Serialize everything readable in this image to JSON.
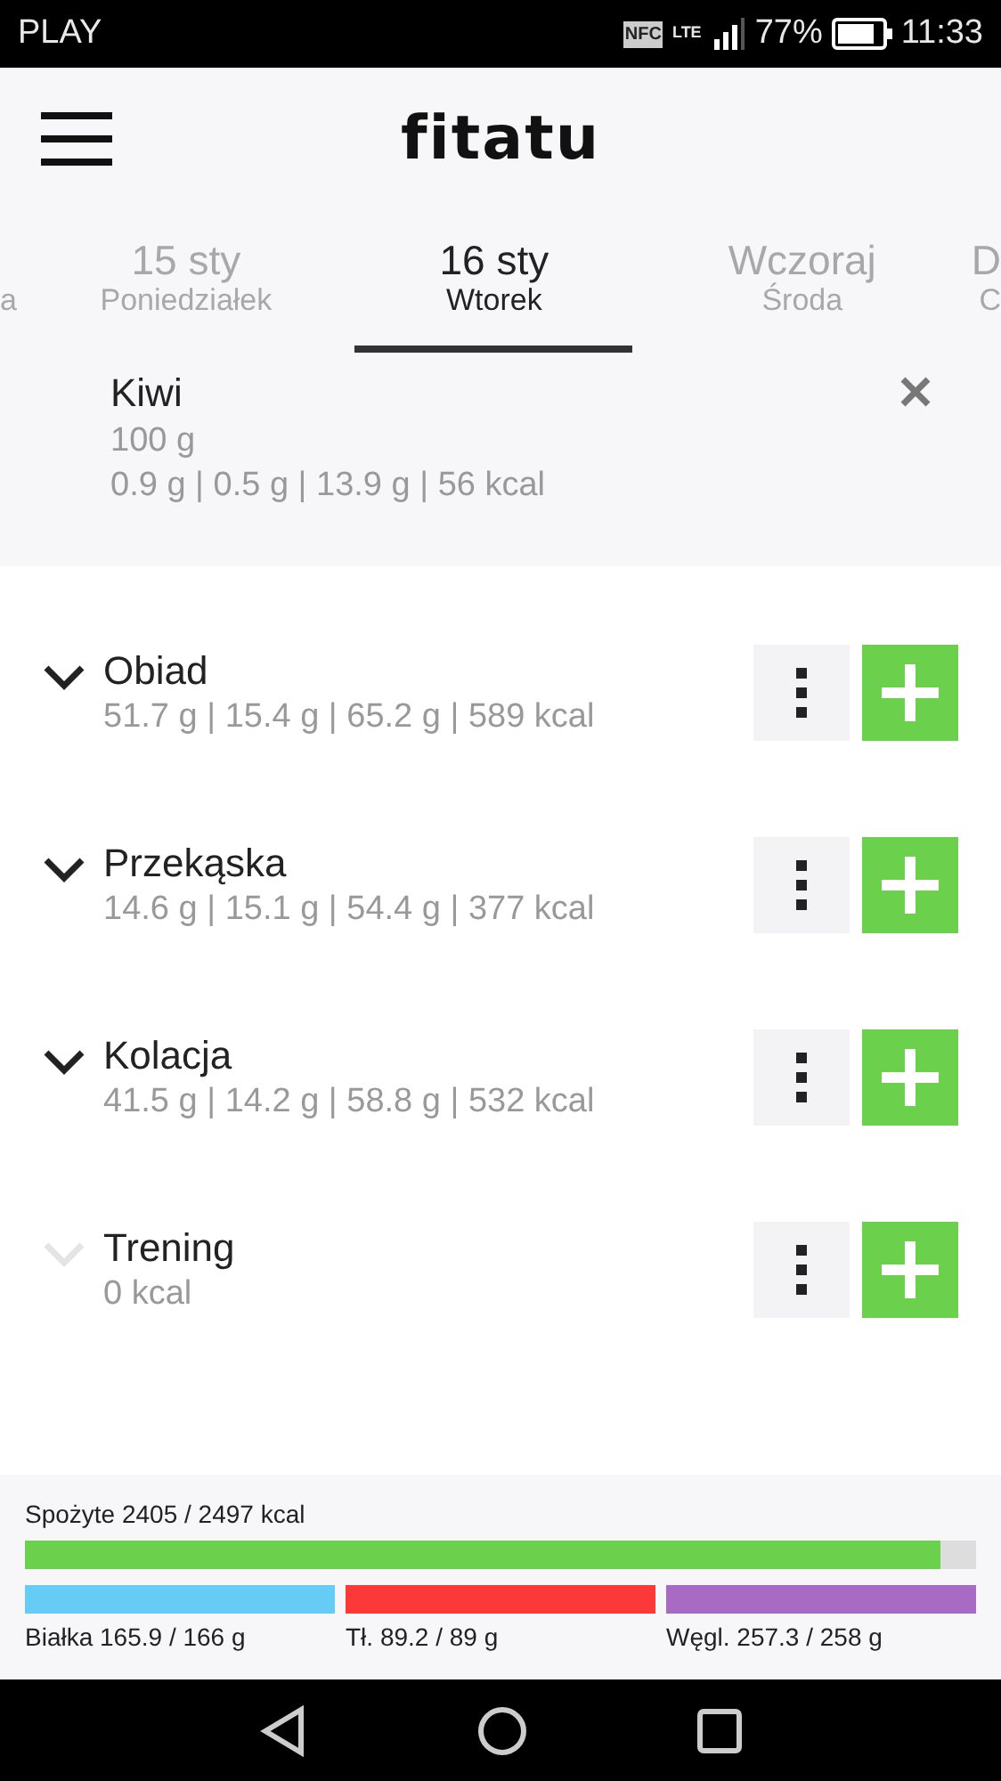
{
  "status_bar": {
    "carrier": "PLAY",
    "nfc": "NFC",
    "network": "LTE",
    "battery": "77%",
    "time": "11:33"
  },
  "header": {
    "logo": "fitatu"
  },
  "tabs": [
    {
      "sub": "a",
      "selected": false,
      "kind": "edge-left"
    },
    {
      "date": "15 sty",
      "sub": "Poniedziałek",
      "selected": false,
      "kind": "full"
    },
    {
      "date": "16 sty",
      "sub": "Wtorek",
      "selected": true,
      "kind": "full"
    },
    {
      "date": "Wczoraj",
      "sub": "Środa",
      "selected": false,
      "kind": "full"
    },
    {
      "date": "D",
      "sub": "C",
      "selected": false,
      "kind": "edge-right"
    }
  ],
  "item": {
    "name": "Kiwi",
    "amount": "100 g",
    "nutrients": "0.9 g | 0.5 g | 13.9 g | 56 kcal"
  },
  "meals": [
    {
      "name": "Obiad",
      "summary": "51.7 g | 15.4 g | 65.2 g | 589 kcal",
      "has_items": true
    },
    {
      "name": "Przekąska",
      "summary": "14.6 g | 15.1 g | 54.4 g | 377 kcal",
      "has_items": true
    },
    {
      "name": "Kolacja",
      "summary": "41.5 g | 14.2 g | 58.8 g | 532 kcal",
      "has_items": true
    },
    {
      "name": "Trening",
      "summary": "0 kcal",
      "has_items": false
    }
  ],
  "summary": {
    "calories": {
      "label": "Spożyte 2405 / 2497 kcal",
      "level": 0.963
    },
    "macros": [
      {
        "label": "Białka 165.9 / 166 g",
        "level": 1,
        "color": "#66ccf5"
      },
      {
        "label": "Tł. 89.2 / 89 g",
        "level": 1,
        "color": "#fc3939"
      },
      {
        "label": "Węgl. 257.3 / 258 g",
        "level": 1,
        "color": "#a86bc4"
      }
    ]
  }
}
